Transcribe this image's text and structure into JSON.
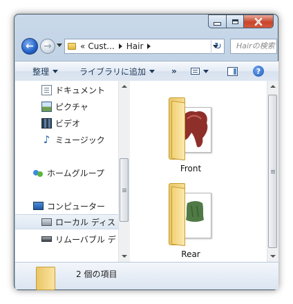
{
  "window": {
    "caption": {
      "minimize_icon": "minimize-icon",
      "maximize_icon": "maximize-icon",
      "close_icon": "close-icon"
    }
  },
  "address": {
    "segments": [
      "Cust...",
      "Hair"
    ],
    "overflow_marker": "«",
    "search_placeholder": "Hairの検索",
    "accent": "#1f5ea8"
  },
  "toolbar": {
    "organize": "整理",
    "add_to_library": "ライブラリに追加",
    "overflow": "»"
  },
  "navigation": {
    "items": [
      {
        "label": "ドキュメント",
        "icon": "document-icon"
      },
      {
        "label": "ピクチャ",
        "icon": "picture-icon"
      },
      {
        "label": "ビデオ",
        "icon": "video-icon"
      },
      {
        "label": "ミュージック",
        "icon": "music-icon"
      },
      {
        "label": "ホームグループ",
        "icon": "homegroup-icon"
      },
      {
        "label": "コンピューター",
        "icon": "computer-icon"
      },
      {
        "label": "ローカル ディス",
        "icon": "local-disk-icon",
        "selected": true
      },
      {
        "label": "リムーバブル デ",
        "icon": "removable-disk-icon"
      }
    ]
  },
  "files": [
    {
      "name": "Front",
      "thumbnail_color": "#8f2f2a"
    },
    {
      "name": "Rear",
      "thumbnail_color": "#4f7a45"
    }
  ],
  "details": {
    "count_text": "2 個の項目"
  }
}
